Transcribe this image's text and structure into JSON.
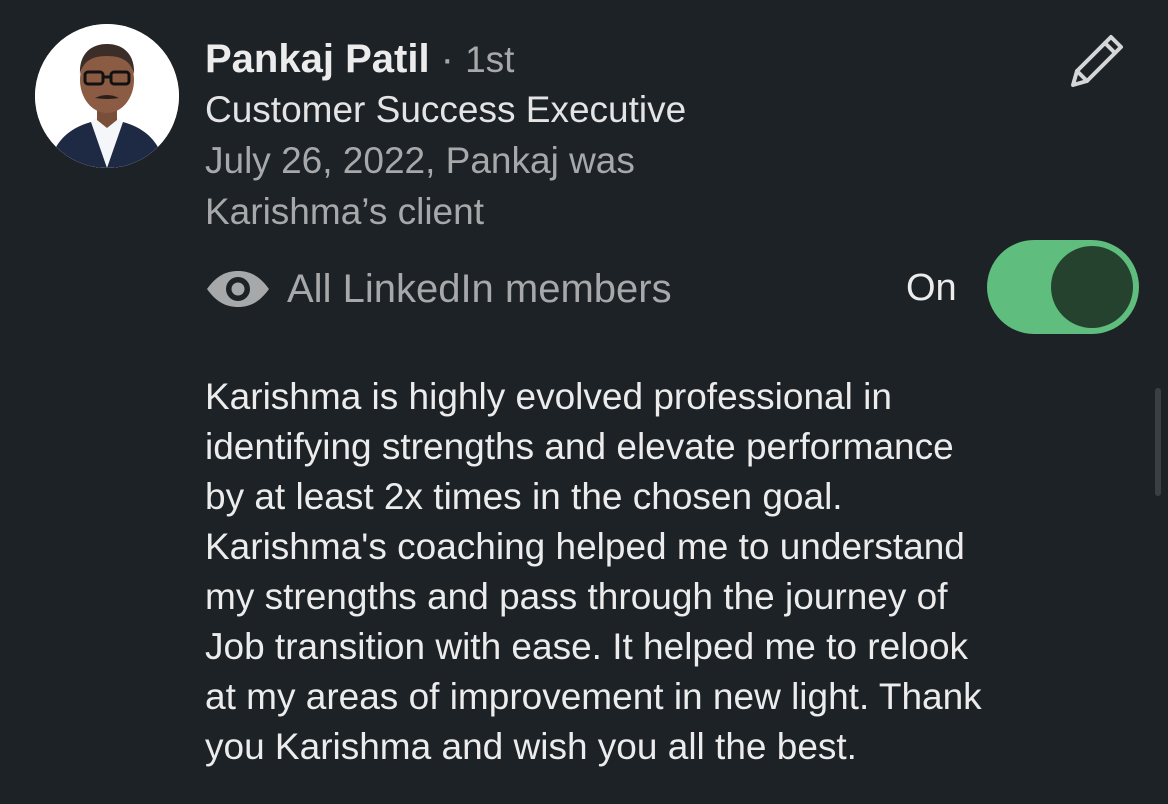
{
  "recommender": {
    "name": "Pankaj Patil",
    "separator": " · ",
    "degree": "1st",
    "headline": "Customer Success Executive",
    "relation": "July 26, 2022, Pankaj was Karishma’s client"
  },
  "visibility": {
    "icon": "eye-icon",
    "label": "All LinkedIn members"
  },
  "toggle": {
    "label": "On",
    "state": true,
    "accent_color": "#5fbd7d"
  },
  "recommendation": {
    "text": "Karishma is highly evolved professional in\nidentifying strengths and elevate performance\nby at least 2x times in the chosen goal.\nKarishma's coaching helped me to understand\nmy strengths and pass through the journey of\nJob transition with ease. It helped me to relook\nat my areas of improvement in new light. Thank\nyou Karishma and wish you all the best."
  },
  "actions": {
    "edit_icon": "pencil-icon"
  }
}
